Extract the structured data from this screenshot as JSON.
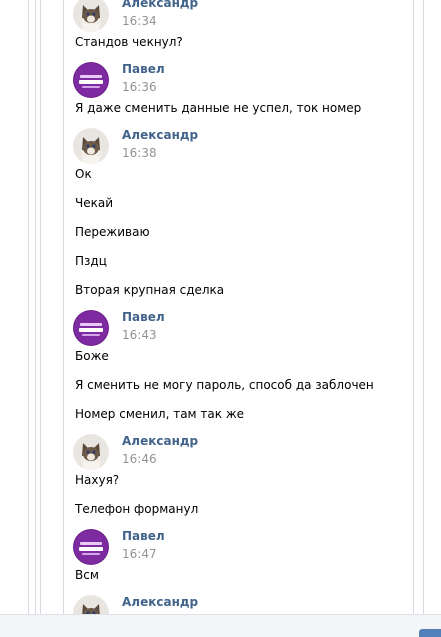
{
  "messages": [
    {
      "author": "Александр",
      "time": "16:34",
      "avatar": "cat-avatar",
      "texts": [
        "Стандов чекнул?"
      ]
    },
    {
      "author": "Павел",
      "time": "16:36",
      "avatar": "purple-logo-avatar",
      "texts": [
        "Я даже сменить данные не успел, ток номер"
      ]
    },
    {
      "author": "Александр",
      "time": "16:38",
      "avatar": "cat-avatar",
      "texts": [
        "Ок",
        "Чекай",
        "Переживаю",
        "Пздц",
        "Вторая крупная сделка"
      ]
    },
    {
      "author": "Павел",
      "time": "16:43",
      "avatar": "purple-logo-avatar",
      "texts": [
        "Боже",
        "Я сменить не могу пароль, способ да заблочен",
        "Номер сменил, там так же"
      ]
    },
    {
      "author": "Александр",
      "time": "16:46",
      "avatar": "cat-avatar",
      "texts": [
        "Нахуя?",
        "Телефон форманул"
      ]
    },
    {
      "author": "Павел",
      "time": "16:47",
      "avatar": "purple-logo-avatar",
      "texts": [
        "Всм"
      ]
    },
    {
      "author": "Александр",
      "time": "",
      "avatar": "cat-avatar",
      "texts": []
    }
  ],
  "colors": {
    "author_link": "#42648b",
    "timestamp": "#939393",
    "send_button": "#5181b8",
    "purple_avatar": "#6a1f8a"
  }
}
